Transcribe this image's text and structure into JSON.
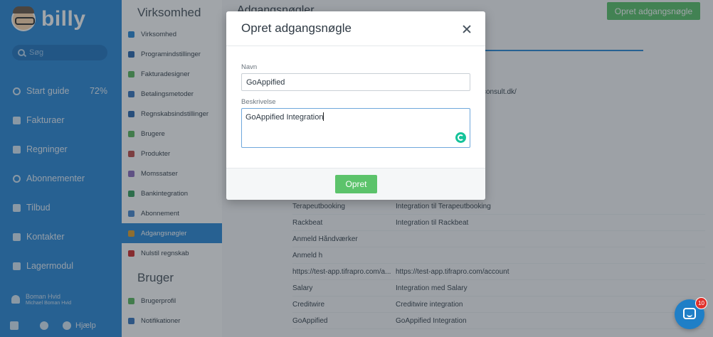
{
  "app": {
    "logo": "billy"
  },
  "sidebar": {
    "search_placeholder": "Søg",
    "items": [
      {
        "label": "Start guide",
        "extra": "72%",
        "icon": "progress-icon"
      },
      {
        "label": "Fakturaer",
        "icon": "invoice-icon"
      },
      {
        "label": "Regninger",
        "icon": "bill-icon"
      },
      {
        "label": "Abonnementer",
        "icon": "subscription-icon"
      },
      {
        "label": "Tilbud",
        "icon": "quote-icon"
      },
      {
        "label": "Kontakter",
        "icon": "contacts-icon"
      },
      {
        "label": "Lagermodul",
        "icon": "warehouse-icon"
      }
    ],
    "user": {
      "name": "Boman Hvid",
      "subname": "Michael Boman Hvid"
    },
    "bottom": {
      "help_label": "Hjælp"
    }
  },
  "settings_menu": {
    "section1": "Virksomhed",
    "items1": [
      {
        "label": "Virksomhed",
        "color": "#2e8ad8"
      },
      {
        "label": "Programindstillinger",
        "color": "#2e6ab0"
      },
      {
        "label": "Fakturadesigner",
        "color": "#5cb860"
      },
      {
        "label": "Betalingsmetoder",
        "color": "#3a78c0"
      },
      {
        "label": "Regnskabsindstillinger",
        "color": "#2e6ab0"
      },
      {
        "label": "Brugere",
        "color": "#5cb860"
      },
      {
        "label": "Produkter",
        "color": "#c0504d"
      },
      {
        "label": "Momssatser",
        "color": "#8e6fc0"
      },
      {
        "label": "Bankintegration",
        "color": "#3aa060"
      },
      {
        "label": "Abonnement",
        "color": "#4a8ad0"
      },
      {
        "label": "Adgangsnøgler",
        "color": "#e0a030",
        "active": true
      },
      {
        "label": "Nulstil regnskab",
        "color": "#d03030"
      }
    ],
    "section2": "Bruger",
    "items2": [
      {
        "label": "Brugerprofil",
        "color": "#5cb860"
      },
      {
        "label": "Notifikationer",
        "color": "#3a78c0"
      }
    ]
  },
  "main": {
    "title": "Adgangsnøgler",
    "create_button": "Opret adgangsnøgle",
    "truncated_text": "consult.dk/",
    "rows": [
      {
        "name": "Terapeutbooking",
        "description": "Integration til Terapeutbooking"
      },
      {
        "name": "Rackbeat",
        "description": "Integration til Rackbeat"
      },
      {
        "name": "Anmeld Håndværker",
        "description": ""
      },
      {
        "name": "Anmeld h",
        "description": ""
      },
      {
        "name": "https://test-app.tifrapro.com/a...",
        "description": "https://test-app.tifrapro.com/account"
      },
      {
        "name": "Salary",
        "description": "Integration med Salary"
      },
      {
        "name": "Creditwire",
        "description": "Creditwire integration"
      },
      {
        "name": "GoAppified",
        "description": "GoAppified Integration"
      }
    ]
  },
  "modal": {
    "title": "Opret adgangsnøgle",
    "name_label": "Navn",
    "name_value": "GoAppified",
    "description_label": "Beskrivelse",
    "description_value": "GoAppified Integration",
    "submit_label": "Opret"
  },
  "chat": {
    "badge_count": "10"
  }
}
